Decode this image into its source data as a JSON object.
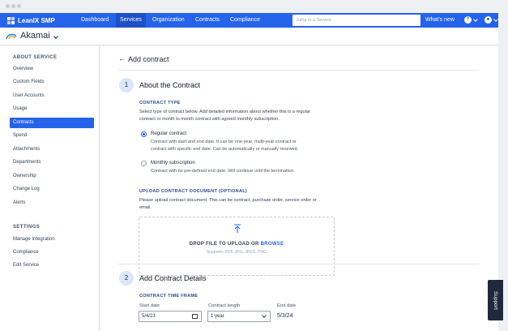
{
  "app": {
    "brand": "LeanIX SMP",
    "nav": [
      "Dashboard",
      "Services",
      "Organization",
      "Contracts",
      "Compliance"
    ],
    "search_placeholder": "Jump to a Service",
    "whats_new": "What's new",
    "help_glyph": "?",
    "colors": {
      "primary": "#2563eb",
      "active_nav": "#1e4fc4",
      "support_tab": "#1e293b"
    }
  },
  "service": {
    "name": "Akamai"
  },
  "sidebar": {
    "about_heading": "ABOUT SERVICE",
    "about_items": [
      "Overview",
      "Custom Fields",
      "User Accounts",
      "Usage",
      "Contracts",
      "Spend",
      "Attachments",
      "Departments",
      "Ownership",
      "Change Log",
      "Alerts"
    ],
    "settings_heading": "SETTINGS",
    "settings_items": [
      "Manage Integration",
      "Compliance",
      "Edit Service"
    ]
  },
  "page": {
    "title": "Add contract",
    "step1": {
      "number": "1",
      "title": "About the Contract",
      "type_label": "CONTRACT TYPE",
      "type_intro_1": "Select type of contract below. Add detailed information about whether this is a regular",
      "type_intro_2": "contract or month to month contract with agreed monthly subscription.",
      "option_regular": {
        "label": "Regular contract",
        "desc_1": "Contract with start and end date. It can be one-year, multi-year contract or",
        "desc_2": "contract with specific end date. Can be automatically or manually renewed.",
        "checked": true
      },
      "option_monthly": {
        "label": "Monthly subscription",
        "desc_1": "Contract with no pre-defined end date. Will continue until the termination.",
        "checked": false
      },
      "upload_label": "UPLOAD CONTRACT DOCUMENT (OPTIONAL)",
      "upload_intro_1": "Please upload contract document. This can be contract, purchase order, service order or",
      "upload_intro_2": "email.",
      "drop_text": "DROP FILE TO UPLOAD OR ",
      "drop_browse": "BROWSE",
      "drop_support": "Supports: PDF, JPG, JPEG, PNG"
    },
    "step2": {
      "number": "2",
      "title": "Add Contract Details",
      "timeframe_label": "CONTRACT TIME FRAME",
      "start_label": "Start date",
      "start_value": "5/4/23",
      "length_label": "Contract length",
      "length_value": "1 year",
      "end_label": "End date",
      "end_value": "5/3/24"
    }
  },
  "support": {
    "label": "Support"
  }
}
